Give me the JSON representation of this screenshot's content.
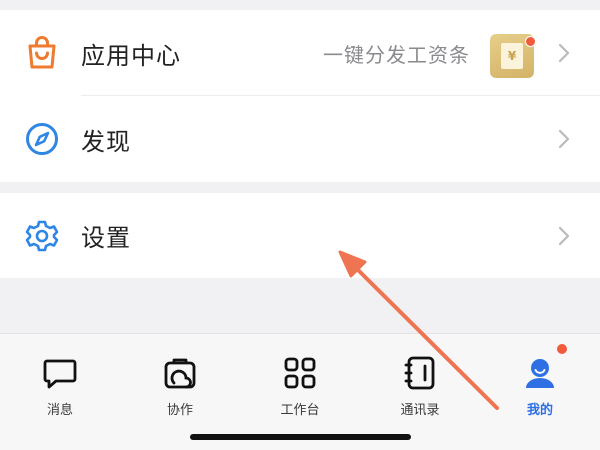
{
  "menu": {
    "items": [
      {
        "label": "应用中心",
        "right_text": "一键分发工资条",
        "icon": "shopping-bag-icon"
      },
      {
        "label": "发现",
        "icon": "compass-icon"
      },
      {
        "label": "设置",
        "icon": "gear-icon"
      }
    ],
    "promo_badge_symbol": "¥"
  },
  "tabbar": {
    "tabs": [
      {
        "label": "消息",
        "icon": "message-icon"
      },
      {
        "label": "协作",
        "icon": "collaboration-icon"
      },
      {
        "label": "工作台",
        "icon": "grid-icon"
      },
      {
        "label": "通讯录",
        "icon": "contacts-icon"
      },
      {
        "label": "我的",
        "icon": "profile-icon",
        "active": true
      }
    ]
  },
  "colors": {
    "accent_blue": "#2f6fe4",
    "icon_orange": "#f07a2d",
    "notification_red": "#f25a3c",
    "annotation_arrow": "#ef7452"
  }
}
